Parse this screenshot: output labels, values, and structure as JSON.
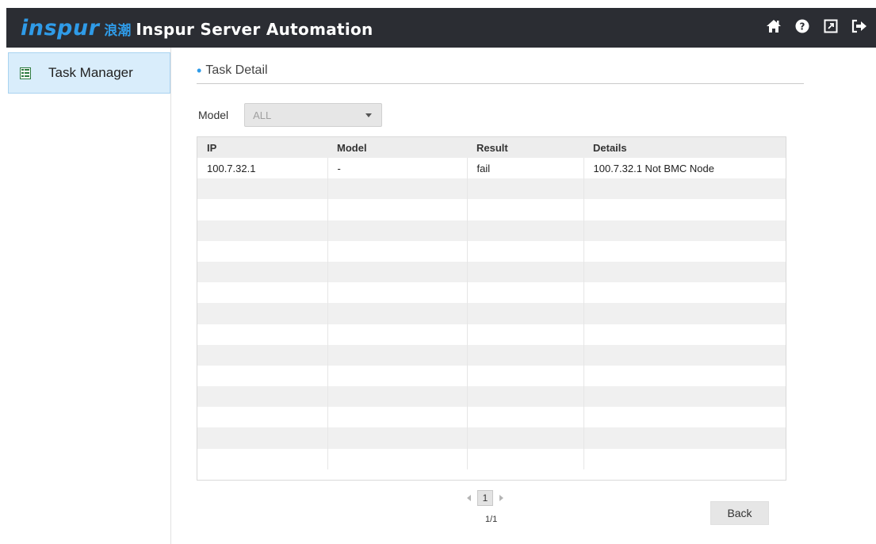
{
  "header": {
    "logo_text": "inspur",
    "logo_cn": "浪潮",
    "app_title": "Inspur Server Automation",
    "icons": [
      "home-icon",
      "help-icon",
      "export-icon",
      "logout-icon"
    ]
  },
  "sidebar": {
    "items": [
      {
        "label": "Task Manager",
        "icon": "task-list-icon",
        "active": true
      }
    ]
  },
  "main": {
    "title": "Task Detail",
    "filter": {
      "label": "Model",
      "selected": "ALL"
    },
    "table": {
      "columns": [
        "IP",
        "Model",
        "Result",
        "Details"
      ],
      "rows": [
        [
          "100.7.32.1",
          "-",
          "fail",
          "100.7.32.1 Not BMC Node"
        ],
        [
          "",
          "",
          "",
          ""
        ],
        [
          "",
          "",
          "",
          ""
        ],
        [
          "",
          "",
          "",
          ""
        ],
        [
          "",
          "",
          "",
          ""
        ],
        [
          "",
          "",
          "",
          ""
        ],
        [
          "",
          "",
          "",
          ""
        ],
        [
          "",
          "",
          "",
          ""
        ],
        [
          "",
          "",
          "",
          ""
        ],
        [
          "",
          "",
          "",
          ""
        ],
        [
          "",
          "",
          "",
          ""
        ],
        [
          "",
          "",
          "",
          ""
        ],
        [
          "",
          "",
          "",
          ""
        ],
        [
          "",
          "",
          "",
          ""
        ],
        [
          "",
          "",
          "",
          ""
        ]
      ]
    },
    "pagination": {
      "current": "1",
      "info": "1/1"
    },
    "back_label": "Back"
  },
  "colors": {
    "accent": "#2f9be8",
    "header_bg": "#2b2d33",
    "sidebar_active": "#d9edfb"
  }
}
